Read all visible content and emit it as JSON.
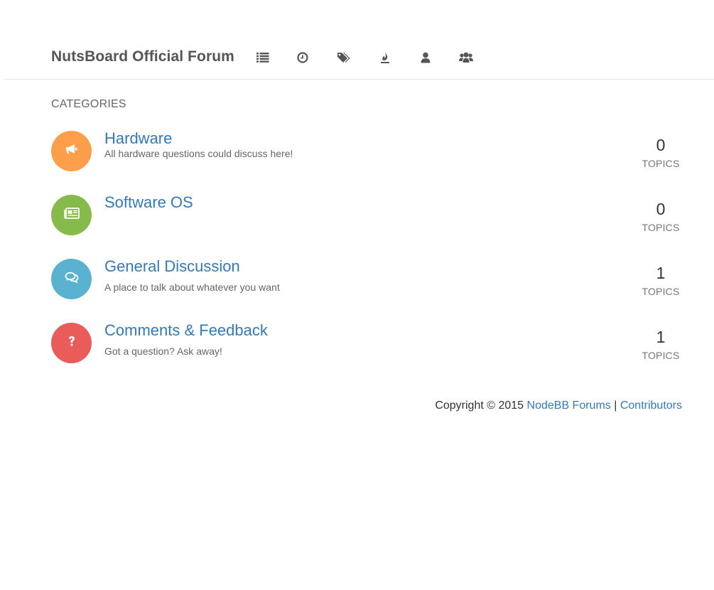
{
  "header": {
    "brand": "NutsBoard Official Forum",
    "nav": [
      {
        "name": "categories",
        "icon": "list-icon"
      },
      {
        "name": "recent",
        "icon": "clock-icon"
      },
      {
        "name": "tags",
        "icon": "tags-icon"
      },
      {
        "name": "popular",
        "icon": "fire-icon"
      },
      {
        "name": "users",
        "icon": "user-icon"
      },
      {
        "name": "groups",
        "icon": "users-icon"
      }
    ]
  },
  "main": {
    "section_title": "CATEGORIES",
    "categories": [
      {
        "title": "Hardware",
        "description": "All hardware questions could discuss here!",
        "count": "0",
        "count_label": "TOPICS",
        "color": "#fd9f4a",
        "icon": "bullhorn-icon"
      },
      {
        "title": "Software OS",
        "description": "",
        "count": "0",
        "count_label": "TOPICS",
        "color": "#86ba4b",
        "icon": "newspaper-icon"
      },
      {
        "title": "General Discussion",
        "description": "A place to talk about whatever you want",
        "count": "1",
        "count_label": "TOPICS",
        "color": "#59b3d0",
        "icon": "comments-icon"
      },
      {
        "title": "Comments & Feedback",
        "description": "Got a question? Ask away!",
        "count": "1",
        "count_label": "TOPICS",
        "color": "#e95c5a",
        "icon": "question-icon"
      }
    ]
  },
  "footer": {
    "copyright": "Copyright © 2015",
    "link_forums": "NodeBB Forums",
    "separator": "|",
    "link_contributors": "Contributors"
  }
}
